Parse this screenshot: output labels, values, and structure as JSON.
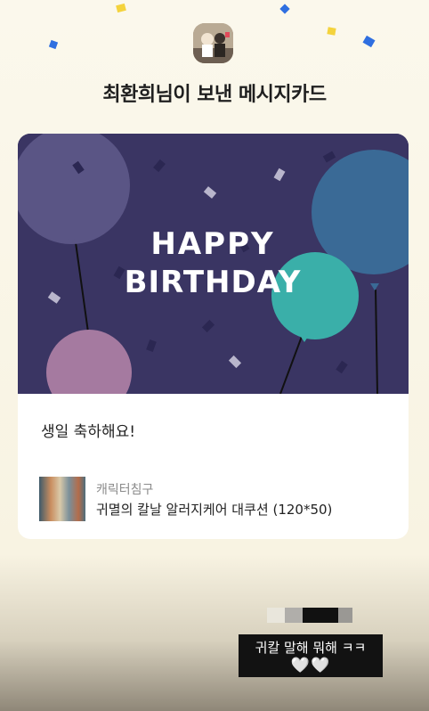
{
  "header": {
    "title": "최환희님이 보낸 메시지카드"
  },
  "card": {
    "art_text_line1": "HAPPY",
    "art_text_line2": "BIRTHDAY",
    "message": "생일 축하해요!",
    "product": {
      "brand": "캐릭터침구",
      "name": "귀멸의 칼날 알러지케어 대쿠션 (120*50)"
    }
  },
  "overlay": {
    "caption_line1": "귀칼 말해 뭐해 ㅋㅋ",
    "caption_line2": "🤍🤍"
  },
  "colors": {
    "background": "#fbf8ec",
    "card_art": "#3a3563",
    "balloon_purple": "#5a5585",
    "balloon_blue": "#3a6a96",
    "balloon_teal": "#3aafa9",
    "balloon_pink": "#a57aa0",
    "confetti_yellow": "#f4d33d",
    "confetti_blue": "#2f6fe0"
  }
}
